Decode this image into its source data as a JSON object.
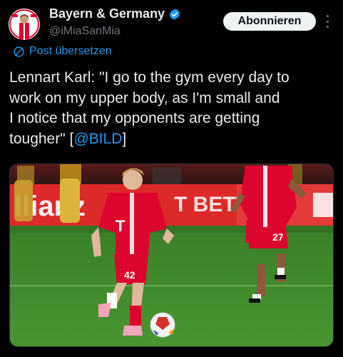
{
  "tweet": {
    "author": {
      "display_name": "Bayern & Germany",
      "handle": "@iMiaSanMia",
      "verified_icon": "verified-badge-icon",
      "avatar_icon": "profile-avatar"
    },
    "subscribe_label": "Abonnieren",
    "translate_label": "Post übersetzen",
    "text_main": "Lennart Karl: \"I go to the gym every day to\nwork on my upper body, as I'm small and\nI notice that my opponents are getting\ntougher\" [",
    "mention": "@BILD",
    "text_end": "]",
    "media": {
      "type": "photo",
      "banner_text_left": "llianz",
      "banner_text_mid": "T BETT",
      "jersey_number_front": "42",
      "jersey_number_back": "27"
    }
  },
  "colors": {
    "background": "#000000",
    "text": "#e7e9ea",
    "secondary_text": "#71767b",
    "link": "#1d9bf0",
    "button_bg": "#eff3f4",
    "jersey_red": "#dc052d",
    "pitch_green": "#3f8a2c"
  }
}
